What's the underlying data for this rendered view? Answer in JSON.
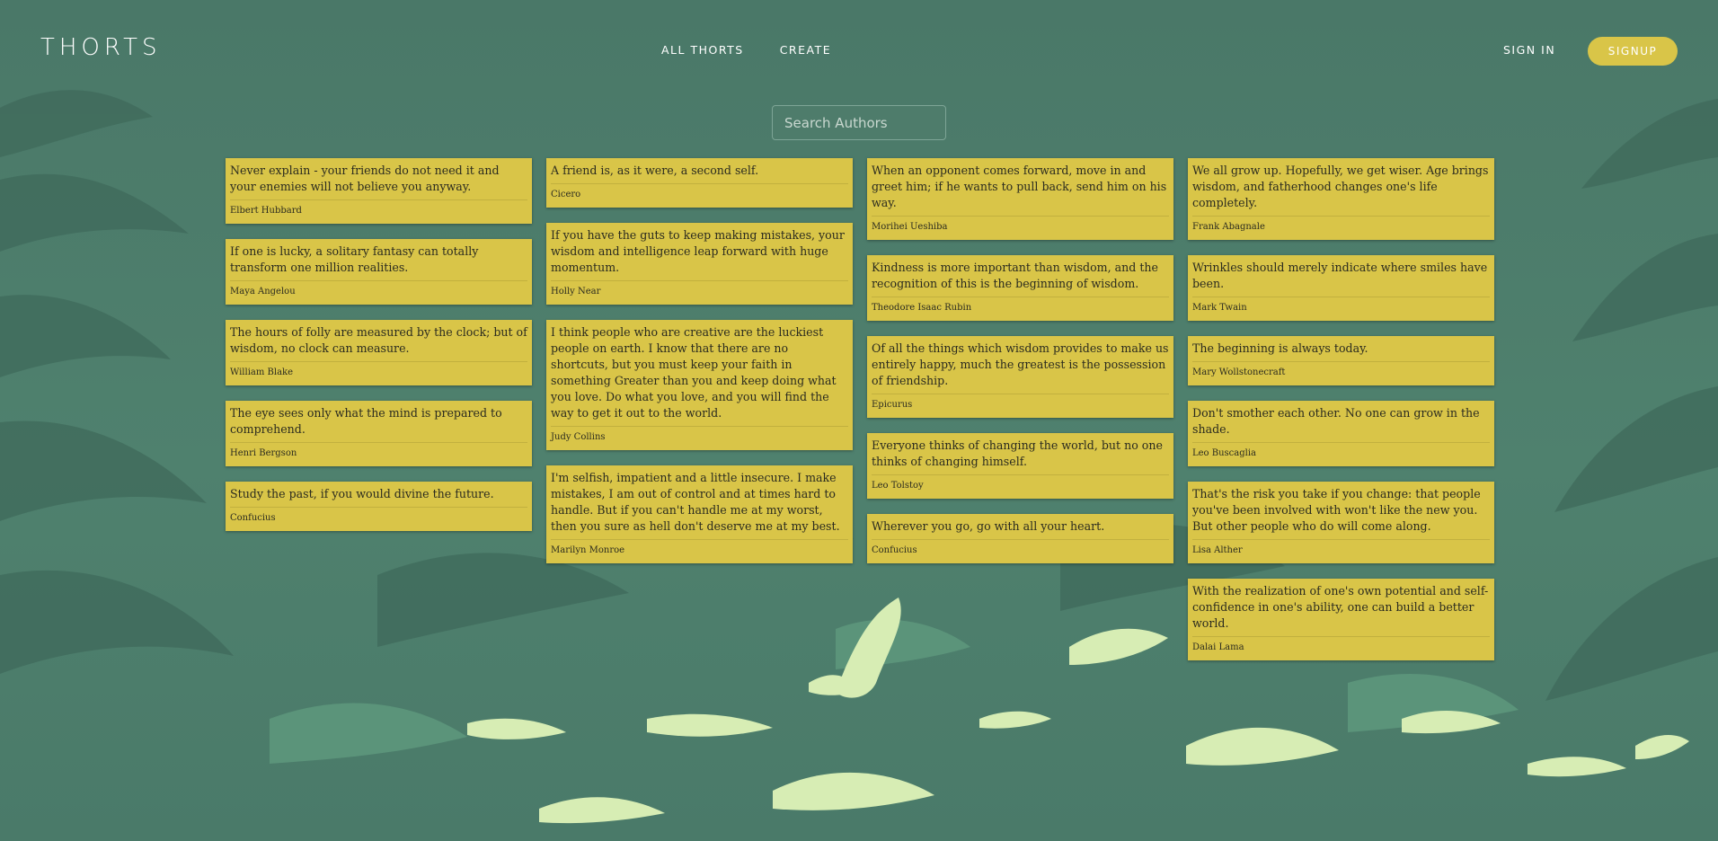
{
  "brand": {
    "logo": "THORTS"
  },
  "nav": {
    "all_thorts": "ALL THORTS",
    "create": "CREATE",
    "sign_in": "SIGN IN",
    "signup": "SIGNUP"
  },
  "search": {
    "placeholder": "Search Authors",
    "value": ""
  },
  "columns": [
    [
      {
        "quote": "Never explain - your friends do not need it and your enemies will not believe you anyway.",
        "author": "Elbert Hubbard"
      },
      {
        "quote": "If one is lucky, a solitary fantasy can totally transform one million realities.",
        "author": "Maya Angelou"
      },
      {
        "quote": "The hours of folly are measured by the clock; but of wisdom, no clock can measure.",
        "author": "William Blake"
      },
      {
        "quote": "The eye sees only what the mind is prepared to comprehend.",
        "author": "Henri Bergson"
      },
      {
        "quote": "Study the past, if you would divine the future.",
        "author": "Confucius"
      }
    ],
    [
      {
        "quote": "A friend is, as it were, a second self.",
        "author": "Cicero"
      },
      {
        "quote": "If you have the guts to keep making mistakes, your wisdom and intelligence leap forward with huge momentum.",
        "author": "Holly Near"
      },
      {
        "quote": "I think people who are creative are the luckiest people on earth. I know that there are no shortcuts, but you must keep your faith in something Greater than you and keep doing what you love. Do what you love, and you will find the way to get it out to the world.",
        "author": "Judy Collins"
      },
      {
        "quote": "I'm selfish, impatient and a little insecure. I make mistakes, I am out of control and at times hard to handle. But if you can't handle me at my worst, then you sure as hell don't deserve me at my best.",
        "author": "Marilyn Monroe"
      }
    ],
    [
      {
        "quote": "When an opponent comes forward, move in and greet him; if he wants to pull back, send him on his way.",
        "author": "Morihei Ueshiba"
      },
      {
        "quote": "Kindness is more important than wisdom, and the recognition of this is the beginning of wisdom.",
        "author": "Theodore Isaac Rubin"
      },
      {
        "quote": "Of all the things which wisdom provides to make us entirely happy, much the greatest is the possession of friendship.",
        "author": "Epicurus"
      },
      {
        "quote": "Everyone thinks of changing the world, but no one thinks of changing himself.",
        "author": "Leo Tolstoy"
      },
      {
        "quote": "Wherever you go, go with all your heart.",
        "author": "Confucius"
      }
    ],
    [
      {
        "quote": "We all grow up. Hopefully, we get wiser. Age brings wisdom, and fatherhood changes one's life completely.",
        "author": "Frank Abagnale"
      },
      {
        "quote": "Wrinkles should merely indicate where smiles have been.",
        "author": "Mark Twain"
      },
      {
        "quote": "The beginning is always today.",
        "author": "Mary Wollstonecraft"
      },
      {
        "quote": "Don't smother each other. No one can grow in the shade.",
        "author": "Leo Buscaglia"
      },
      {
        "quote": "That's the risk you take if you change: that people you've been involved with won't like the new you. But other people who do will come along.",
        "author": "Lisa Alther"
      },
      {
        "quote": "With the realization of one's own potential and self-confidence in one's ability, one can build a better world.",
        "author": "Dalai Lama"
      }
    ]
  ]
}
